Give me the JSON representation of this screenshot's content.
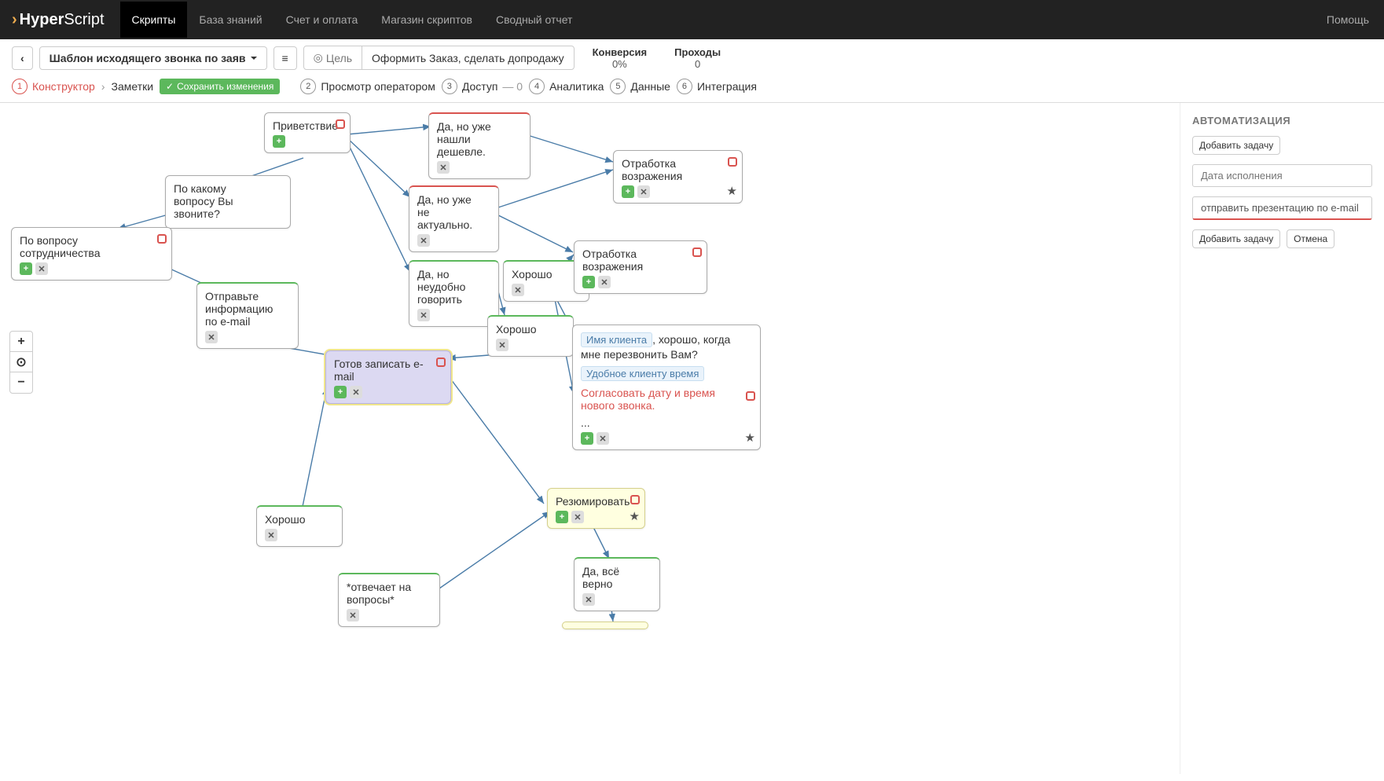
{
  "topbar": {
    "logo_bold": "Hyper",
    "logo_light": "Script",
    "nav": {
      "scripts": "Скрипты",
      "kb": "База знаний",
      "billing": "Счет и оплата",
      "store": "Магазин скриптов",
      "report": "Сводный отчет"
    },
    "help": "Помощь"
  },
  "toolbar": {
    "back_icon": "‹",
    "script_name": "Шаблон исходящего звонка по заяв",
    "menu_icon": "≡",
    "goal_label": "Цель",
    "goal_text": "Оформить Заказ, сделать допродажу",
    "stats": {
      "conv_label": "Конверсия",
      "conv_value": "0%",
      "pass_label": "Проходы",
      "pass_value": "0"
    }
  },
  "subnav": {
    "step1": "Конструктор",
    "notes": "Заметки",
    "save": "Сохранить изменения",
    "step2": "Просмотр оператором",
    "step3": "Доступ",
    "step3_count": "— 0",
    "step4": "Аналитика",
    "step5": "Данные",
    "step6": "Интеграция"
  },
  "zoom": {
    "plus": "+",
    "center": "⊙",
    "minus": "−"
  },
  "side": {
    "title": "АВТОМАТИЗАЦИЯ",
    "add_task": "Добавить задачу",
    "date_placeholder": "Дата исполнения",
    "task_value": "отправить презентацию по e-mail",
    "add_task2": "Добавить задачу",
    "cancel": "Отмена"
  },
  "nodes": {
    "n1": "Приветствие",
    "n2": "По какому вопросу Вы звоните?",
    "n3": "По вопросу сотрудничества",
    "n4": "Отправьте информацию по e-mail",
    "n5": "Да, но уже нашли дешевле.",
    "n6": "Да, но уже не актуально.",
    "n7": "Да, но неудобно говорить",
    "n8": "Хорошо",
    "n9": "Хорошо",
    "n10": "Отработка возражения",
    "n11": "Отработка возражения",
    "n12": "Готов записать e-mail",
    "n13_var1": "Имя клиента",
    "n13_text1": ", хорошо, когда мне перезвонить Вам?",
    "n13_var2": "Удобное клиенту время",
    "n13_red": "Согласовать дату и время нового звонка.",
    "n13_dots": "...",
    "n14": "Хорошо",
    "n15": "Резюмировать",
    "n16": "Да, всё верно",
    "n17": "*отвечает на вопросы*"
  }
}
